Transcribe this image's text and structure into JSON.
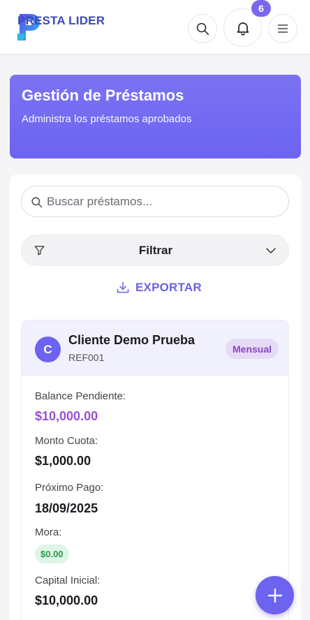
{
  "header": {
    "logo_text": "PRESTA LIDER",
    "notification_count": "6"
  },
  "banner": {
    "title": "Gestión de Préstamos",
    "subtitle": "Administra los préstamos aprobados"
  },
  "search": {
    "placeholder": "Buscar préstamos..."
  },
  "filter": {
    "label": "Filtrar"
  },
  "export": {
    "label": "EXPORTAR"
  },
  "loan": {
    "avatar_initial": "C",
    "client_name": "Cliente Demo Prueba",
    "reference": "REF001",
    "frequency": "Mensual",
    "fields": {
      "balance_label": "Balance Pendiente:",
      "balance_value": "$10,000.00",
      "installment_label": "Monto Cuota:",
      "installment_value": "$1,000.00",
      "next_payment_label": "Próximo Pago:",
      "next_payment_value": "18/09/2025",
      "mora_label": "Mora:",
      "mora_value": "$0.00",
      "initial_capital_label": "Capital Inicial:",
      "initial_capital_value": "$10,000.00"
    }
  },
  "icons": {
    "search": "search-icon",
    "bell": "bell-icon",
    "menu": "hamburger-icon",
    "filter": "funnel-icon",
    "chevron": "chevron-down-icon",
    "download": "download-icon",
    "add": "plus-icon"
  },
  "colors": {
    "accent": "#6c63f0",
    "purple_text": "#9a4fcf",
    "success": "#2e9a4d"
  }
}
